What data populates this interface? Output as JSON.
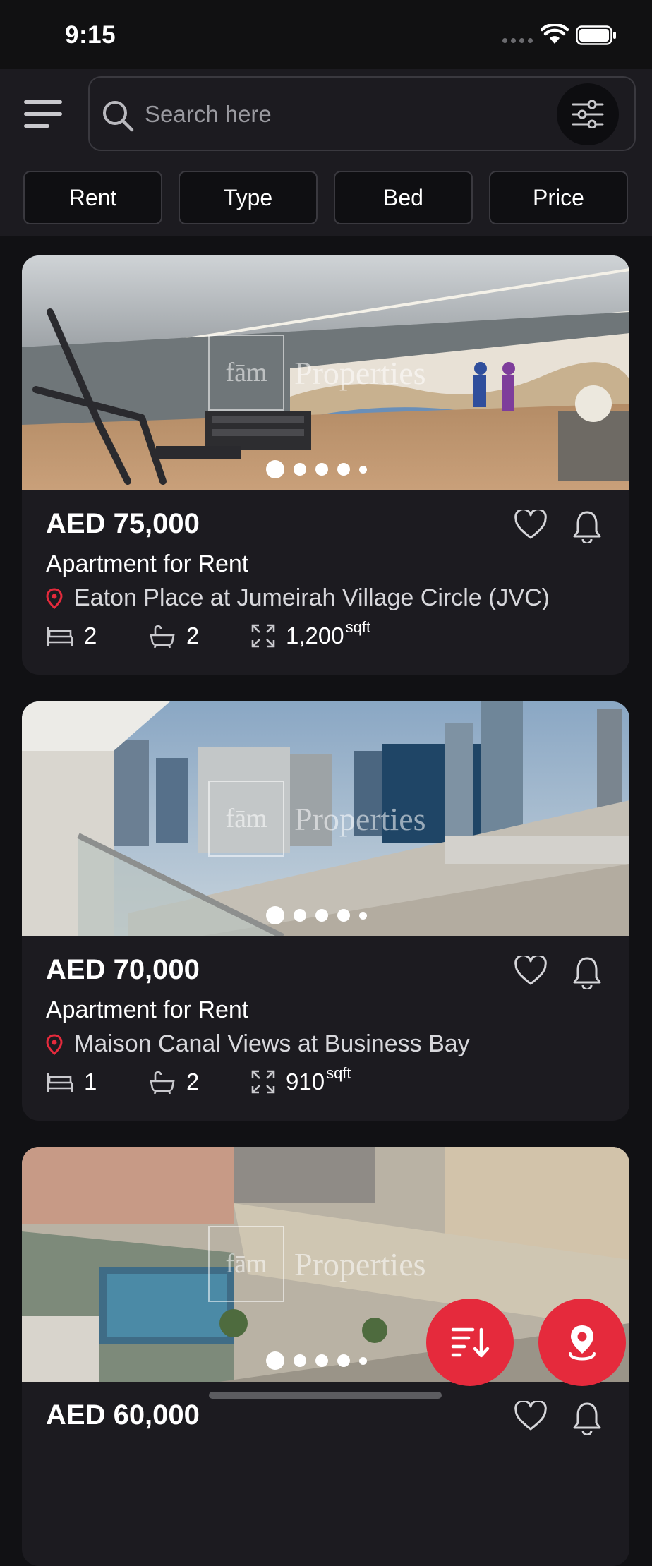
{
  "status_bar": {
    "time": "9:15"
  },
  "search": {
    "placeholder": "Search here"
  },
  "filters": [
    "Rent",
    "Type",
    "Bed",
    "Price"
  ],
  "watermark": {
    "logo": "fām",
    "text": "Properties"
  },
  "listings": [
    {
      "price": "AED 75,000",
      "type": "Apartment for Rent",
      "location": "Eaton Place at Jumeirah Village Circle (JVC)",
      "beds": "2",
      "baths": "2",
      "area": "1,200",
      "area_unit": "sqft",
      "photo": "gym interior with mural"
    },
    {
      "price": "AED 70,000",
      "type": "Apartment for Rent",
      "location": "Maison Canal Views at Business Bay",
      "beds": "1",
      "baths": "2",
      "area": "910",
      "area_unit": "sqft",
      "photo": "balcony view of city skyline"
    },
    {
      "price": "AED 60,000",
      "photo": "aerial view of pool and buildings"
    }
  ],
  "colors": {
    "accent": "#e52a3c",
    "background": "#111114",
    "card": "#1c1b20"
  },
  "icons": [
    "menu-icon",
    "search-icon",
    "sliders-icon",
    "heart-icon",
    "bell-icon",
    "location-pin-icon",
    "bed-icon",
    "bathtub-icon",
    "area-icon",
    "sort-icon",
    "map-pin-icon"
  ]
}
